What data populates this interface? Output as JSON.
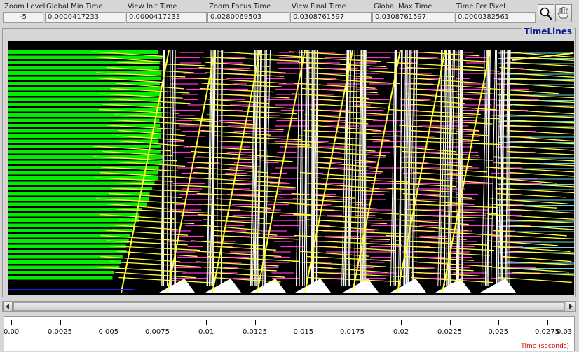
{
  "header": {
    "fields": [
      {
        "key": "zoom_level",
        "label": "Zoom Level",
        "value": "-5"
      },
      {
        "key": "global_min_time",
        "label": "Global Min Time",
        "value": "0.0000417233"
      },
      {
        "key": "view_init_time",
        "label": "View  Init Time",
        "value": "0.0000417233"
      },
      {
        "key": "zoom_focus_time",
        "label": "Zoom Focus Time",
        "value": "0.0280069503"
      },
      {
        "key": "view_final_time",
        "label": "View Final Time",
        "value": "0.0308761597"
      },
      {
        "key": "global_max_time",
        "label": "Global Max Time",
        "value": "0.0308761597"
      },
      {
        "key": "time_per_pixel",
        "label": "Time Per Pixel",
        "value": "0.0000382561"
      }
    ],
    "tools": [
      {
        "name": "zoom-tool",
        "icon": "magnifier-icon",
        "active": true
      },
      {
        "name": "hand-tool",
        "icon": "hand-icon",
        "active": false
      }
    ]
  },
  "panel": {
    "title": "TimeLines"
  },
  "timeline_colors": {
    "background": "#000000",
    "state": "#00ee00",
    "arrow": "#ffff33",
    "event": "#ffffff",
    "marker": "#ff33cc",
    "idle_line": "#66dddd",
    "blue_line": "#2222ff"
  },
  "axis": {
    "ticks": [
      "0.00",
      "0.0025",
      "0.005",
      "0.0075",
      "0.01",
      "0.0125",
      "0.015",
      "0.0175",
      "0.02",
      "0.0225",
      "0.025",
      "0.0275",
      "0.03"
    ],
    "title": "Time (seconds)"
  }
}
